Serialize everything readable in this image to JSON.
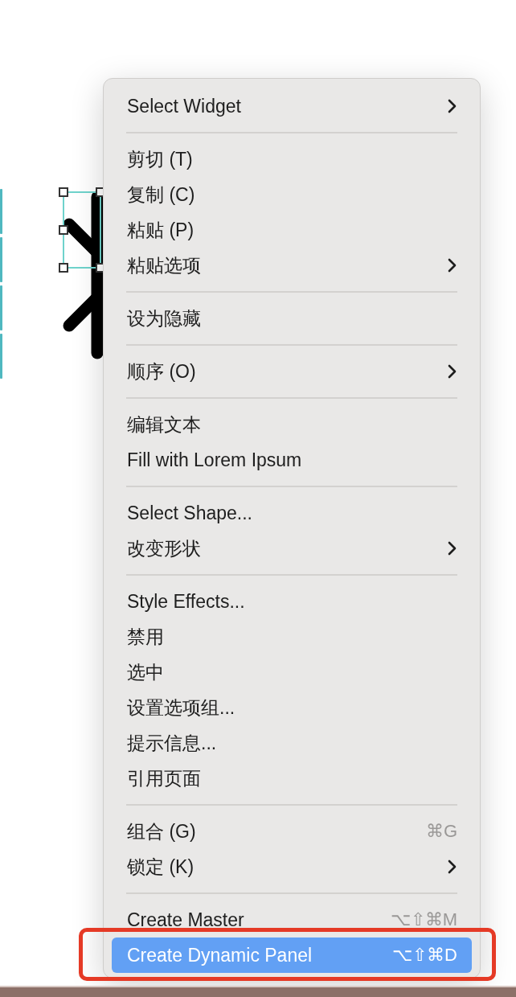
{
  "canvas": {
    "widget": {
      "selected": true
    }
  },
  "context_menu": {
    "groups": [
      [
        {
          "label": "Select Widget",
          "submenu": true,
          "selected": false
        }
      ],
      [
        {
          "label": "剪切 (T)",
          "submenu": false,
          "selected": false
        },
        {
          "label": "复制 (C)",
          "submenu": false,
          "selected": false
        },
        {
          "label": "粘贴 (P)",
          "submenu": false,
          "selected": false
        },
        {
          "label": "粘贴选项",
          "submenu": true,
          "selected": false
        }
      ],
      [
        {
          "label": "设为隐藏",
          "submenu": false,
          "selected": false
        }
      ],
      [
        {
          "label": "顺序 (O)",
          "submenu": true,
          "selected": false
        }
      ],
      [
        {
          "label": "编辑文本",
          "submenu": false,
          "selected": false
        },
        {
          "label": "Fill with Lorem Ipsum",
          "submenu": false,
          "selected": false
        }
      ],
      [
        {
          "label": "Select Shape...",
          "submenu": false,
          "selected": false
        },
        {
          "label": "改变形状",
          "submenu": true,
          "selected": false
        }
      ],
      [
        {
          "label": "Style Effects...",
          "submenu": false,
          "selected": false
        },
        {
          "label": "禁用",
          "submenu": false,
          "selected": false
        },
        {
          "label": "选中",
          "submenu": false,
          "selected": false
        },
        {
          "label": "设置选项组...",
          "submenu": false,
          "selected": false
        },
        {
          "label": "提示信息...",
          "submenu": false,
          "selected": false
        },
        {
          "label": "引用页面",
          "submenu": false,
          "selected": false
        }
      ],
      [
        {
          "label": "组合 (G)",
          "shortcut": "⌘G",
          "submenu": false,
          "selected": false
        },
        {
          "label": "锁定 (K)",
          "submenu": true,
          "selected": false
        }
      ],
      [
        {
          "label": "Create Master",
          "shortcut": "⌥⇧⌘M",
          "submenu": false,
          "selected": false
        },
        {
          "label": "Create Dynamic Panel",
          "shortcut": "⌥⇧⌘D",
          "submenu": false,
          "selected": true,
          "highlighted": true
        }
      ]
    ]
  }
}
